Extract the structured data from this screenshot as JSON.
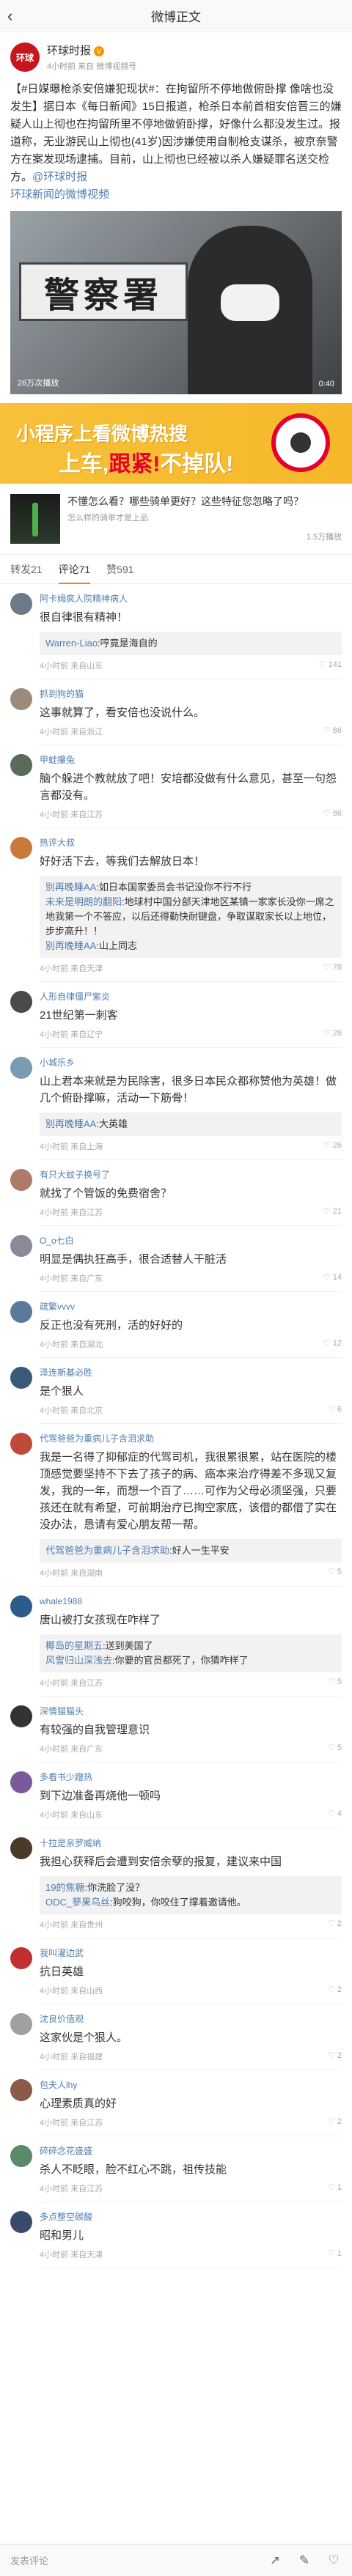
{
  "nav": {
    "title": "微博正文",
    "back": "‹"
  },
  "post": {
    "author": "环球时报",
    "avatar_text": "环球",
    "meta": "4小时前 来自 微博视频号",
    "text_pre": "【#日媒曝枪杀安倍嫌犯现状#：在拘留所不停地做俯卧撑 像啥也没发生】据日本《每日新闻》15日报道，枪杀日本前首相安倍晋三的嫌疑人山上彻也在拘留所里不停地做俯卧撑，好像什么都没发生过。报道称，无业游民山上彻也(41岁)因涉嫌使用自制枪支谋杀，被京奈警方在案发现场逮捕。目前，山上彻也已经被以杀人嫌疑罪名送交检方。",
    "mention": "@环球时报",
    "video_link": "环球新闻的微博视频",
    "video_views": "26万次播放",
    "video_duration": "0:40",
    "video_sign": "警察署"
  },
  "banner": {
    "line1": "小程序上看微博热搜",
    "line2_a": "上车,",
    "line2_b": "跟紧!",
    "line2_c": "不掉队!"
  },
  "ad": {
    "title": "不懂怎么看？哪些骑单更好？这些特征您忽略了吗？",
    "sub": "怎么样的骑单才是上品",
    "plays": "1.5万播放"
  },
  "tabs": [
    {
      "label": "转发21"
    },
    {
      "label": "评论71"
    },
    {
      "label": "赞591"
    }
  ],
  "comments": [
    {
      "name": "阿卡姆疯人院精神病人",
      "avatar_color": "#6c7a8a",
      "text": "很自律很有精神！",
      "replies": [
        {
          "name": "Warren-Liao",
          "text": "哼竟是海自的"
        }
      ],
      "meta": "4小时前 来自山东",
      "likes": "141"
    },
    {
      "name": "抓到狗的猫",
      "avatar_color": "#9c8b7a",
      "text": "这事就算了，看安倍也没说什么。",
      "replies": [],
      "meta": "4小时前 来自浙江",
      "likes": "86"
    },
    {
      "name": "甲蛙攥兔",
      "avatar_color": "#5a6b5a",
      "text": "脑个躲进个教就放了吧！安培都没做有什么意见，甚至一句怨言都没有。",
      "replies": [],
      "meta": "4小时前 来自江苏",
      "likes": "86"
    },
    {
      "name": "热评大叔",
      "avatar_color": "#c87a3a",
      "text": "好好活下去，等我们去解放日本！",
      "replies": [
        {
          "name": "别再晚睡AA",
          "text": "如日本国家委员会书记没你不行不行"
        },
        {
          "name": "未来是明朗的翻阳",
          "text": "地球村中国分部天津地区某镇一家家长没你一席之地我第一个不答应，以后还得勤快耐键盘，争取谋取家长以上地位，步步高升！！"
        },
        {
          "name": "别再晚睡AA",
          "text": "山上同志"
        }
      ],
      "meta": "4小时前 来自天津",
      "likes": "78"
    },
    {
      "name": "人形自律僵尸紫炎",
      "avatar_color": "#4a4a4a",
      "text": "21世纪第一刺客",
      "replies": [],
      "meta": "4小时前 来自辽宁",
      "likes": "28"
    },
    {
      "name": "小城乐乡",
      "avatar_color": "#7a9bb0",
      "text": "山上君本来就是为民除害，很多日本民众都称赞他为英雄！做几个俯卧撑嘛，活动一下筋骨！",
      "replies": [
        {
          "name": "别再晚睡AA",
          "text": "大英雄"
        }
      ],
      "meta": "4小时前 来自上海",
      "likes": "26"
    },
    {
      "name": "有只大蚊子换号了",
      "avatar_color": "#b07a6a",
      "text": "就找了个管饭的免费宿舍？",
      "replies": [],
      "meta": "4小时前 来自江苏",
      "likes": "21"
    },
    {
      "name": "O_o七白",
      "avatar_color": "#8a8a9a",
      "text": "明显是偶执狂高手，很合适替人干脏活",
      "replies": [],
      "meta": "4小时前 来自广东",
      "likes": "14"
    },
    {
      "name": "疏繁vvvv",
      "avatar_color": "#5a7a9a",
      "text": "反正也没有死刑，活的好好的",
      "replies": [],
      "meta": "4小时前 来自湖北",
      "likes": "12"
    },
    {
      "name": "泽连斯基必胜",
      "avatar_color": "#3a5a7a",
      "text": "是个狠人",
      "replies": [],
      "meta": "4小时前 来自北京",
      "likes": "6"
    },
    {
      "name": "代驾爸爸为重病儿子含泪求助",
      "avatar_color": "#c04a3a",
      "text": "我是一名得了抑郁症的代驾司机，我很累很累，站在医院的楼顶感觉要坚持不下去了孩子的病、癌本来治疗得差不多现又复发，我的一年，而想一个百了……可作为父母必须坚强，只要孩还在就有希望，可前期治疗已掏空家底，该借的都借了实在没办法，恳请有爱心朋友帮一帮。",
      "replies": [
        {
          "name": "代驾爸爸为重病儿子含泪求助",
          "text": "好人一生平安"
        }
      ],
      "meta": "4小时前 来自湖南",
      "likes": "5"
    },
    {
      "name": "whale1988",
      "avatar_color": "#2c5d8a",
      "text": "唐山被打女孩现在咋样了",
      "replies": [
        {
          "name": "椰岛的星期五",
          "text": "送到美国了"
        },
        {
          "name": "风雪归山深浅去",
          "text": "你要的官员都死了，你猜咋样了"
        }
      ],
      "meta": "4小时前 来自江苏",
      "likes": "5"
    },
    {
      "name": "深情猫猫头",
      "avatar_color": "#333333",
      "text": "有较强的自我管理意识",
      "replies": [],
      "meta": "4小时前 来自广东",
      "likes": "5"
    },
    {
      "name": "多看书少蹭热",
      "avatar_color": "#7a5a9a",
      "text": "到下边准备再烧他一顿吗",
      "replies": [],
      "meta": "4小时前 来自山东",
      "likes": "4"
    },
    {
      "name": "十拉是亲罗威纳",
      "avatar_color": "#4a3a2a",
      "text": "我担心获释后会遭到安倍余孽的报复，建议来中国",
      "replies": [
        {
          "name": "19的焦糖",
          "text": "你洗脸了没？"
        },
        {
          "name": "ODC_蓼果乌丝",
          "text": "狗咬狗，你咬住了撑着邀请他。"
        }
      ],
      "meta": "4小时前 来自贵州",
      "likes": "2"
    },
    {
      "name": "我叫濯边武",
      "avatar_color": "#c03030",
      "text": "抗日英雄",
      "replies": [],
      "meta": "4小时前 来自山西",
      "likes": "2"
    },
    {
      "name": "沈良价值观",
      "avatar_color": "#a0a0a0",
      "text": "这家伙是个狠人。",
      "replies": [],
      "meta": "4小时前 来自福建",
      "likes": "2"
    },
    {
      "name": "包夫人lhy",
      "avatar_color": "#8a5a4a",
      "text": "心理素质真的好",
      "replies": [],
      "meta": "4小时前 来自江苏",
      "likes": "2"
    },
    {
      "name": "碎碎念花盛盛",
      "avatar_color": "#5a8a6a",
      "text": "杀人不眨眼，脸不红心不跳，祖传技能",
      "replies": [],
      "meta": "4小时前 来自江苏",
      "likes": "1"
    },
    {
      "name": "多点整空碳酸",
      "avatar_color": "#3a4a6a",
      "text": "昭和男儿",
      "replies": [],
      "meta": "4小时前 来自天津",
      "likes": "1"
    }
  ],
  "bottom": {
    "placeholder": "发表评论",
    "icons": [
      "share-icon",
      "comment-icon",
      "like-icon"
    ]
  }
}
